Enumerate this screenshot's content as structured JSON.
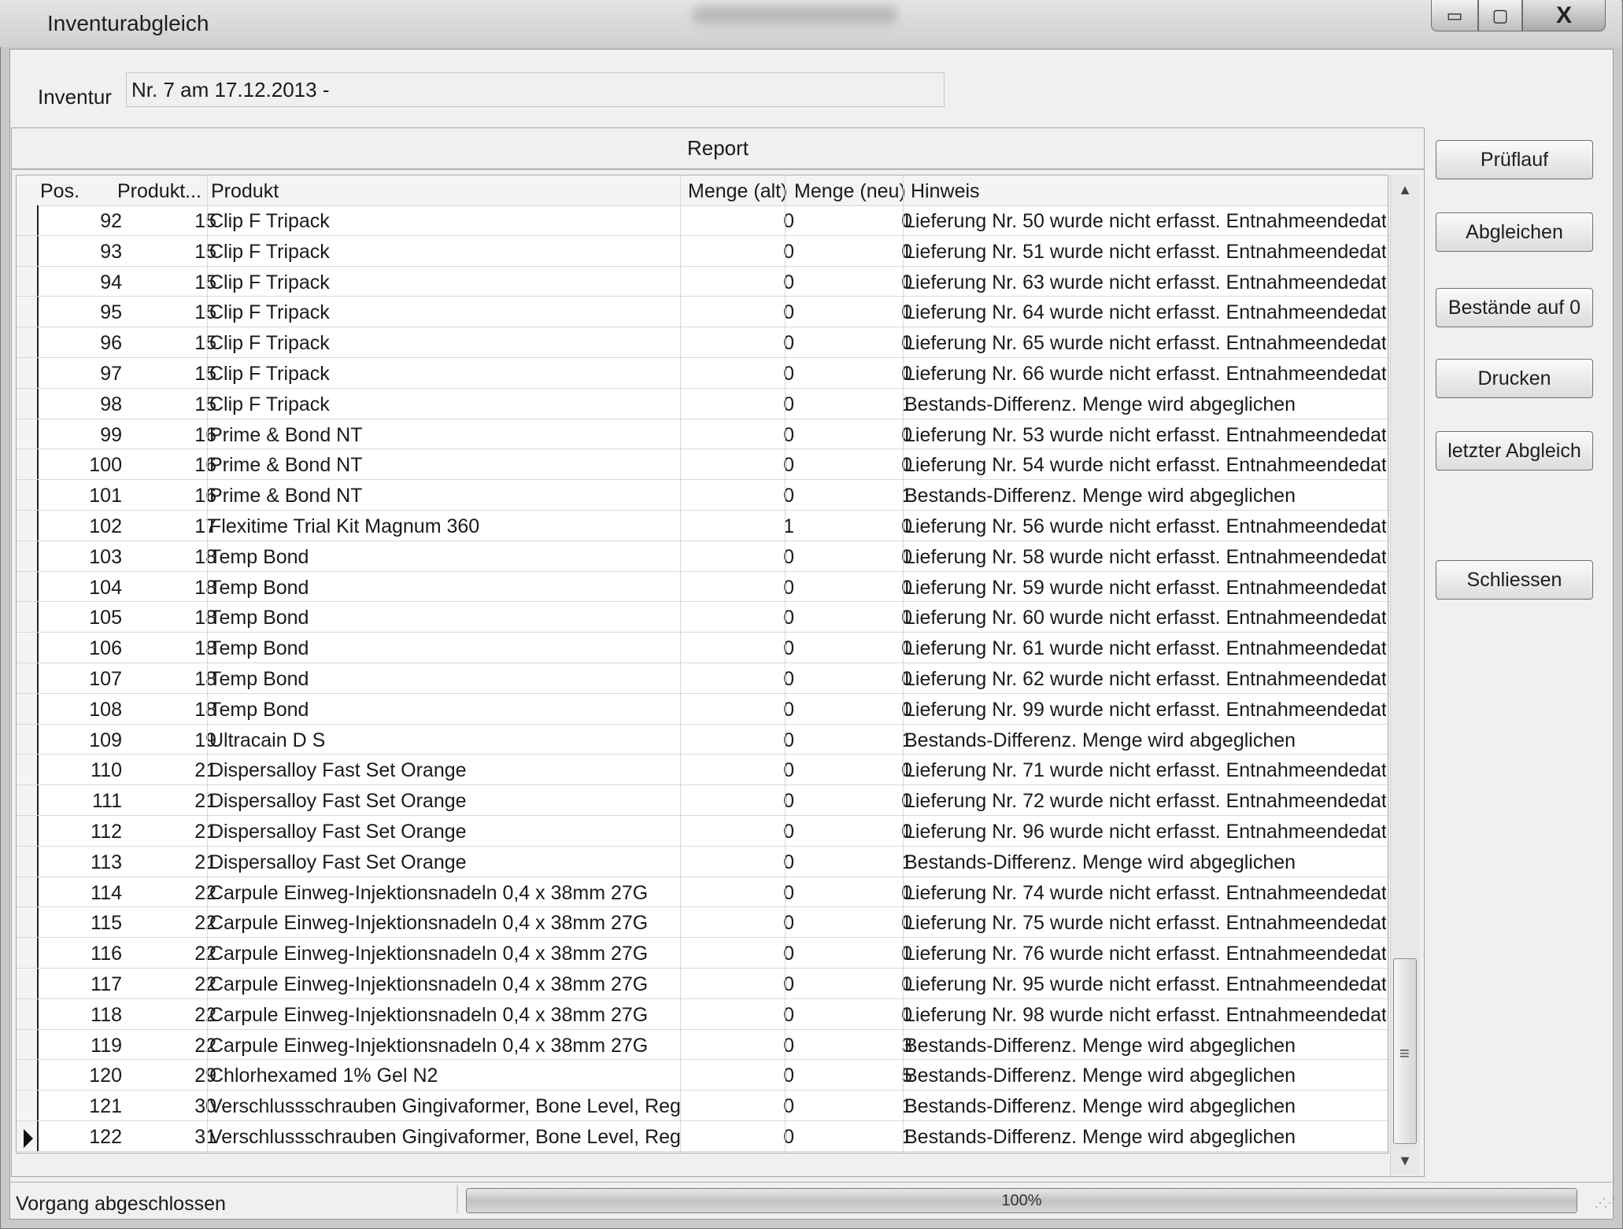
{
  "window": {
    "title": "Inventurabgleich",
    "controls": {
      "minimize": "▭",
      "maximize": "▢",
      "close": "X"
    }
  },
  "inventur": {
    "label": "Inventur",
    "value": "Nr. 7 am 17.12.2013 -"
  },
  "report": {
    "title": "Report",
    "columns": [
      "Pos.",
      "Produkt...",
      "Produkt",
      "Menge (alt)",
      "Menge (neu)",
      "Hinweis"
    ],
    "rows": [
      {
        "pos": "92",
        "pn": "15",
        "produkt": "Clip F Tripack",
        "alt": "0",
        "neu": "0",
        "hinweis": "Lieferung Nr. 50 wurde nicht erfasst. Entnahmeendedat"
      },
      {
        "pos": "93",
        "pn": "15",
        "produkt": "Clip F Tripack",
        "alt": "0",
        "neu": "0",
        "hinweis": "Lieferung Nr. 51 wurde nicht erfasst. Entnahmeendedat"
      },
      {
        "pos": "94",
        "pn": "15",
        "produkt": "Clip F Tripack",
        "alt": "0",
        "neu": "0",
        "hinweis": "Lieferung Nr. 63 wurde nicht erfasst. Entnahmeendedat"
      },
      {
        "pos": "95",
        "pn": "15",
        "produkt": "Clip F Tripack",
        "alt": "0",
        "neu": "0",
        "hinweis": "Lieferung Nr. 64 wurde nicht erfasst. Entnahmeendedat"
      },
      {
        "pos": "96",
        "pn": "15",
        "produkt": "Clip F Tripack",
        "alt": "0",
        "neu": "0",
        "hinweis": "Lieferung Nr. 65 wurde nicht erfasst. Entnahmeendedat"
      },
      {
        "pos": "97",
        "pn": "15",
        "produkt": "Clip F Tripack",
        "alt": "0",
        "neu": "0",
        "hinweis": "Lieferung Nr. 66 wurde nicht erfasst. Entnahmeendedat"
      },
      {
        "pos": "98",
        "pn": "15",
        "produkt": "Clip F Tripack",
        "alt": "0",
        "neu": "1",
        "hinweis": "Bestands-Differenz. Menge wird abgeglichen"
      },
      {
        "pos": "99",
        "pn": "16",
        "produkt": "Prime & Bond NT",
        "alt": "0",
        "neu": "0",
        "hinweis": "Lieferung Nr. 53 wurde nicht erfasst. Entnahmeendedat"
      },
      {
        "pos": "100",
        "pn": "16",
        "produkt": "Prime & Bond NT",
        "alt": "0",
        "neu": "0",
        "hinweis": "Lieferung Nr. 54 wurde nicht erfasst. Entnahmeendedat"
      },
      {
        "pos": "101",
        "pn": "16",
        "produkt": "Prime & Bond NT",
        "alt": "0",
        "neu": "1",
        "hinweis": "Bestands-Differenz. Menge wird abgeglichen"
      },
      {
        "pos": "102",
        "pn": "17",
        "produkt": "Flexitime Trial Kit Magnum 360",
        "alt": "1",
        "neu": "0",
        "hinweis": "Lieferung Nr. 56 wurde nicht erfasst. Entnahmeendedat"
      },
      {
        "pos": "103",
        "pn": "18",
        "produkt": "Temp Bond",
        "alt": "0",
        "neu": "0",
        "hinweis": "Lieferung Nr. 58 wurde nicht erfasst. Entnahmeendedat"
      },
      {
        "pos": "104",
        "pn": "18",
        "produkt": "Temp Bond",
        "alt": "0",
        "neu": "0",
        "hinweis": "Lieferung Nr. 59 wurde nicht erfasst. Entnahmeendedat"
      },
      {
        "pos": "105",
        "pn": "18",
        "produkt": "Temp Bond",
        "alt": "0",
        "neu": "0",
        "hinweis": "Lieferung Nr. 60 wurde nicht erfasst. Entnahmeendedat"
      },
      {
        "pos": "106",
        "pn": "18",
        "produkt": "Temp Bond",
        "alt": "0",
        "neu": "0",
        "hinweis": "Lieferung Nr. 61 wurde nicht erfasst. Entnahmeendedat"
      },
      {
        "pos": "107",
        "pn": "18",
        "produkt": "Temp Bond",
        "alt": "0",
        "neu": "0",
        "hinweis": "Lieferung Nr. 62 wurde nicht erfasst. Entnahmeendedat"
      },
      {
        "pos": "108",
        "pn": "18",
        "produkt": "Temp Bond",
        "alt": "0",
        "neu": "0",
        "hinweis": "Lieferung Nr. 99 wurde nicht erfasst. Entnahmeendedat"
      },
      {
        "pos": "109",
        "pn": "19",
        "produkt": "Ultracain D S",
        "alt": "0",
        "neu": "1",
        "hinweis": "Bestands-Differenz. Menge wird abgeglichen"
      },
      {
        "pos": "110",
        "pn": "21",
        "produkt": "Dispersalloy Fast Set Orange",
        "alt": "0",
        "neu": "0",
        "hinweis": "Lieferung Nr. 71 wurde nicht erfasst. Entnahmeendedat"
      },
      {
        "pos": "111",
        "pn": "21",
        "produkt": "Dispersalloy Fast Set Orange",
        "alt": "0",
        "neu": "0",
        "hinweis": "Lieferung Nr. 72 wurde nicht erfasst. Entnahmeendedat"
      },
      {
        "pos": "112",
        "pn": "21",
        "produkt": "Dispersalloy Fast Set Orange",
        "alt": "0",
        "neu": "0",
        "hinweis": "Lieferung Nr. 96 wurde nicht erfasst. Entnahmeendedat"
      },
      {
        "pos": "113",
        "pn": "21",
        "produkt": "Dispersalloy Fast Set Orange",
        "alt": "0",
        "neu": "1",
        "hinweis": "Bestands-Differenz. Menge wird abgeglichen"
      },
      {
        "pos": "114",
        "pn": "22",
        "produkt": "Carpule Einweg-Injektionsnadeln 0,4 x 38mm 27G",
        "alt": "0",
        "neu": "0",
        "hinweis": "Lieferung Nr. 74 wurde nicht erfasst. Entnahmeendedat"
      },
      {
        "pos": "115",
        "pn": "22",
        "produkt": "Carpule Einweg-Injektionsnadeln 0,4 x 38mm 27G",
        "alt": "0",
        "neu": "0",
        "hinweis": "Lieferung Nr. 75 wurde nicht erfasst. Entnahmeendedat"
      },
      {
        "pos": "116",
        "pn": "22",
        "produkt": "Carpule Einweg-Injektionsnadeln 0,4 x 38mm 27G",
        "alt": "0",
        "neu": "0",
        "hinweis": "Lieferung Nr. 76 wurde nicht erfasst. Entnahmeendedat"
      },
      {
        "pos": "117",
        "pn": "22",
        "produkt": "Carpule Einweg-Injektionsnadeln 0,4 x 38mm 27G",
        "alt": "0",
        "neu": "0",
        "hinweis": "Lieferung Nr. 95 wurde nicht erfasst. Entnahmeendedat"
      },
      {
        "pos": "118",
        "pn": "22",
        "produkt": "Carpule Einweg-Injektionsnadeln 0,4 x 38mm 27G",
        "alt": "0",
        "neu": "0",
        "hinweis": "Lieferung Nr. 98 wurde nicht erfasst. Entnahmeendedat"
      },
      {
        "pos": "119",
        "pn": "22",
        "produkt": "Carpule Einweg-Injektionsnadeln 0,4 x 38mm 27G",
        "alt": "0",
        "neu": "3",
        "hinweis": "Bestands-Differenz. Menge wird abgeglichen"
      },
      {
        "pos": "120",
        "pn": "29",
        "produkt": "Chlorhexamed 1% Gel N2",
        "alt": "0",
        "neu": "5",
        "hinweis": "Bestands-Differenz. Menge wird abgeglichen"
      },
      {
        "pos": "121",
        "pn": "30",
        "produkt": "Verschlussschrauben Gingivaformer, Bone Level, Regu",
        "alt": "0",
        "neu": "1",
        "hinweis": "Bestands-Differenz. Menge wird abgeglichen"
      },
      {
        "pos": "122",
        "pn": "31",
        "produkt": "Verschlussschrauben Gingivaformer, Bone Level, Regu",
        "alt": "0",
        "neu": "1",
        "hinweis": "Bestands-Differenz. Menge wird abgeglichen",
        "current": true
      }
    ]
  },
  "scrollbar": {
    "up": "▲",
    "down": "▼",
    "grip": "≡"
  },
  "buttons": {
    "prueflauf": "Prüflauf",
    "abgleichen": "Abgleichen",
    "bestaende": "Bestände auf 0",
    "drucken": "Drucken",
    "letzter": "letzter Abgleich",
    "schliessen": "Schliessen"
  },
  "status": {
    "text": "Vorgang abgeschlossen",
    "progress_label": "100%",
    "progress_fraction": 1.0
  },
  "colors": {
    "frame": "#c9c9c9",
    "client": "#f0f0f0",
    "grid_bg": "#ffffff"
  },
  "icons": {
    "current_row": "row-pointer-icon",
    "resize_grip": "resize-grip-icon"
  }
}
